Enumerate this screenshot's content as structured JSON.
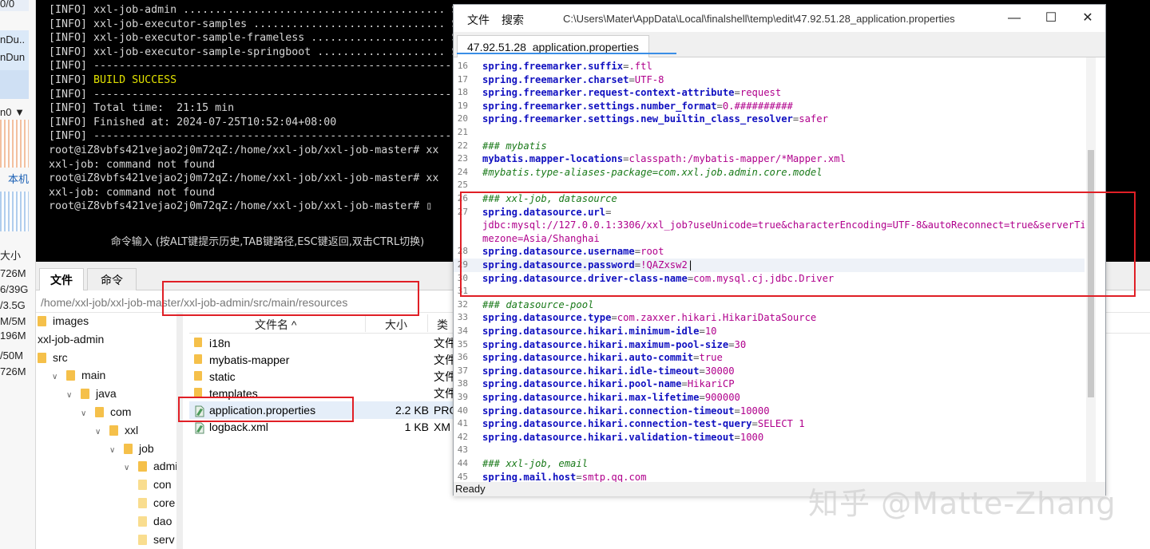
{
  "left_sliver": {
    "lines": [
      "0/0",
      "nDu..",
      "nDun",
      "n0 ▼",
      "本机",
      "大小",
      "726M",
      "6/39G",
      "/3.5G",
      "M/5M",
      "196M",
      "/50M",
      "726M"
    ]
  },
  "terminal": {
    "lines": [
      {
        "text": "[INFO] xxl-job-admin ......................................... S"
      },
      {
        "text": "[INFO] xxl-job-executor-samples .............................. S"
      },
      {
        "text": "[INFO] xxl-job-executor-sample-frameless ..................... S"
      },
      {
        "text": "[INFO] xxl-job-executor-sample-springboot .................... S"
      },
      {
        "text": "[INFO] ------------------------------------------------------------------------"
      },
      {
        "prefix": "[INFO] ",
        "highlight": "BUILD SUCCESS"
      },
      {
        "text": "[INFO] ------------------------------------------------------------------------"
      },
      {
        "text": "[INFO] Total time:  21:15 min"
      },
      {
        "text": "[INFO] Finished at: 2024-07-25T10:52:04+08:00"
      },
      {
        "text": "[INFO] ------------------------------------------------------------------------"
      },
      {
        "text": "root@iZ8vbfs421vejao2j0m72qZ:/home/xxl-job/xxl-job-master# xx"
      },
      {
        "text": "xxl-job: command not found"
      },
      {
        "text": "root@iZ8vbfs421vejao2j0m72qZ:/home/xxl-job/xxl-job-master# xx"
      },
      {
        "text": "xxl-job: command not found"
      },
      {
        "text": "root@iZ8vbfs421vejao2j0m72qZ:/home/xxl-job/xxl-job-master# ▯"
      }
    ],
    "hint": "命令输入 (按ALT键提示历史,TAB键路径,ESC键返回,双击CTRL切换)"
  },
  "file_manager": {
    "tabs": [
      "文件",
      "命令"
    ],
    "path": "/home/xxl-job/xxl-job-master/xxl-job-admin/src/main/resources",
    "tree": [
      {
        "label": "images",
        "depth": 0,
        "chev": ""
      },
      {
        "label": "xxl-job-admin",
        "depth": 0,
        "chev": "",
        "nofolder": true
      },
      {
        "label": "src",
        "depth": 0,
        "chev": ""
      },
      {
        "label": "main",
        "depth": 1,
        "chev": "∨"
      },
      {
        "label": "java",
        "depth": 2,
        "chev": "∨"
      },
      {
        "label": "com",
        "depth": 3,
        "chev": "∨"
      },
      {
        "label": "xxl",
        "depth": 4,
        "chev": "∨"
      },
      {
        "label": "job",
        "depth": 5,
        "chev": "∨"
      },
      {
        "label": "admin",
        "depth": 6,
        "chev": "∨"
      },
      {
        "label": "con",
        "depth": 7,
        "chev": "",
        "pale": true
      },
      {
        "label": "core",
        "depth": 7,
        "chev": "",
        "pale": true
      },
      {
        "label": "dao",
        "depth": 7,
        "chev": "",
        "pale": true
      },
      {
        "label": "serv",
        "depth": 7,
        "chev": "",
        "pale": true
      }
    ],
    "columns": {
      "name": "文件名 ^",
      "size": "大小",
      "type": "类"
    },
    "files": [
      {
        "name": "i18n",
        "size": "",
        "type": "文件",
        "icon": "folder"
      },
      {
        "name": "mybatis-mapper",
        "size": "",
        "type": "文件",
        "icon": "folder"
      },
      {
        "name": "static",
        "size": "",
        "type": "文件",
        "icon": "folder"
      },
      {
        "name": "templates",
        "size": "",
        "type": "文件",
        "icon": "folder"
      },
      {
        "name": "application.properties",
        "size": "2.2 KB",
        "type": "PRO",
        "icon": "file",
        "selected": true
      },
      {
        "name": "logback.xml",
        "size": "1 KB",
        "type": "XM",
        "icon": "file"
      }
    ]
  },
  "editor": {
    "menu": [
      "文件",
      "搜索"
    ],
    "window_path": "C:\\Users\\Mater\\AppData\\Local\\finalshell\\temp\\edit\\47.92.51.28_application.properties",
    "tab": "47.92.51.28_application.properties",
    "status": "Ready",
    "lines": [
      {
        "n": "16",
        "k": "spring.freemarker.suffix",
        "v": ".ftl"
      },
      {
        "n": "17",
        "k": "spring.freemarker.charset",
        "v": "UTF-8"
      },
      {
        "n": "18",
        "k": "spring.freemarker.request-context-attribute",
        "v": "request"
      },
      {
        "n": "19",
        "k": "spring.freemarker.settings.number_format",
        "v": "0.##########"
      },
      {
        "n": "20",
        "k": "spring.freemarker.settings.new_builtin_class_resolver",
        "v": "safer"
      },
      {
        "n": "21"
      },
      {
        "n": "22",
        "c": "### mybatis"
      },
      {
        "n": "23",
        "k": "mybatis.mapper-locations",
        "v": "classpath:/mybatis-mapper/*Mapper.xml"
      },
      {
        "n": "24",
        "c": "#mybatis.type-aliases-package=com.xxl.job.admin.core.model"
      },
      {
        "n": "25"
      },
      {
        "n": "26",
        "c": "### xxl-job, datasource"
      },
      {
        "n": "27",
        "k": "spring.datasource.url",
        "v": ""
      },
      {
        "n": "",
        "v2": "jdbc:mysql://127.0.0.1:3306/xxl_job?useUnicode=true&characterEncoding=UTF-8&autoReconnect=true&serverTi"
      },
      {
        "n": "",
        "v2": "mezone=Asia/Shanghai"
      },
      {
        "n": "28",
        "k": "spring.datasource.username",
        "v": "root"
      },
      {
        "n": "29",
        "k": "spring.datasource.password",
        "v": "!QAZxsw2",
        "cur": true
      },
      {
        "n": "30",
        "k": "spring.datasource.driver-class-name",
        "v": "com.mysql.cj.jdbc.Driver"
      },
      {
        "n": "31"
      },
      {
        "n": "32",
        "c": "### datasource-pool"
      },
      {
        "n": "33",
        "k": "spring.datasource.type",
        "v": "com.zaxxer.hikari.HikariDataSource"
      },
      {
        "n": "34",
        "k": "spring.datasource.hikari.minimum-idle",
        "v": "10"
      },
      {
        "n": "35",
        "k": "spring.datasource.hikari.maximum-pool-size",
        "v": "30"
      },
      {
        "n": "36",
        "k": "spring.datasource.hikari.auto-commit",
        "v": "true"
      },
      {
        "n": "37",
        "k": "spring.datasource.hikari.idle-timeout",
        "v": "30000"
      },
      {
        "n": "38",
        "k": "spring.datasource.hikari.pool-name",
        "v": "HikariCP"
      },
      {
        "n": "39",
        "k": "spring.datasource.hikari.max-lifetime",
        "v": "900000"
      },
      {
        "n": "40",
        "k": "spring.datasource.hikari.connection-timeout",
        "v": "10000"
      },
      {
        "n": "41",
        "k": "spring.datasource.hikari.connection-test-query",
        "v": "SELECT 1"
      },
      {
        "n": "42",
        "k": "spring.datasource.hikari.validation-timeout",
        "v": "1000"
      },
      {
        "n": "43"
      },
      {
        "n": "44",
        "c": "### xxl-job, email"
      },
      {
        "n": "45",
        "k": "spring.mail.host",
        "v": "smtp.qq.com"
      }
    ]
  },
  "watermark": "知乎 @Matte-Zhang",
  "colors": {
    "highlight_box": "#e01f26",
    "key": "#1010c0",
    "value": "#b0008c",
    "comment": "#1a7a1a",
    "success": "#e0e000"
  }
}
